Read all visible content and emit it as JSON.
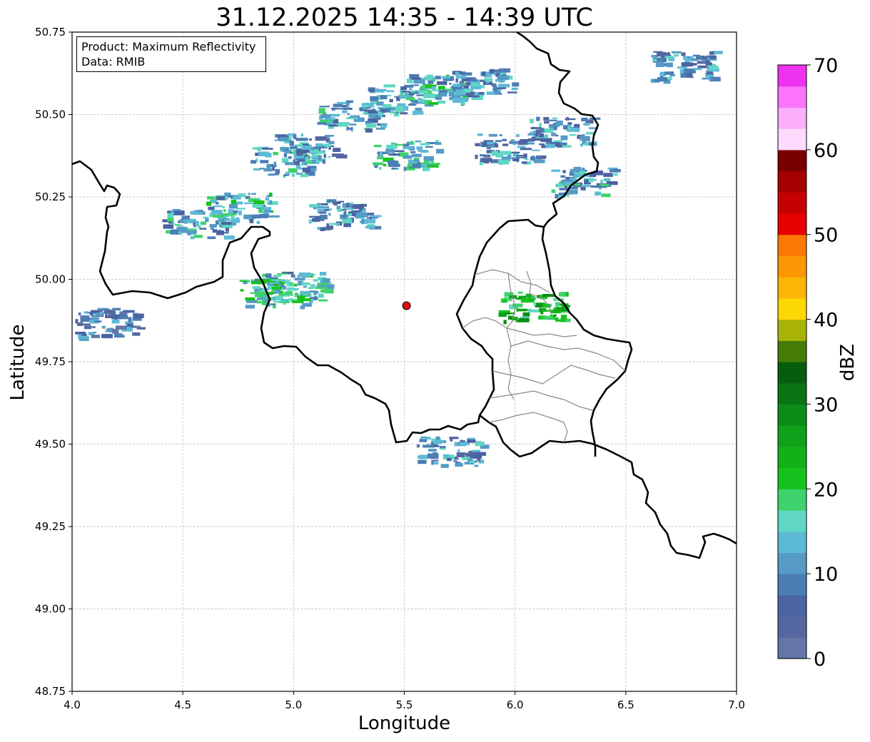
{
  "title": "31.12.2025 14:35 - 14:39 UTC",
  "infobox": {
    "product_line": "Product: Maximum Reflectivity",
    "data_line": "Data: RMIB"
  },
  "axes": {
    "xlabel": "Longitude",
    "ylabel": "Latitude",
    "xlim": [
      4.0,
      7.0
    ],
    "ylim": [
      48.75,
      50.75
    ],
    "xticks": [
      "4.0",
      "4.5",
      "5.0",
      "5.5",
      "6.0",
      "6.5",
      "7.0"
    ],
    "yticks": [
      "48.75",
      "49.00",
      "49.25",
      "49.50",
      "49.75",
      "50.00",
      "50.25",
      "50.50",
      "50.75"
    ],
    "grid": true
  },
  "radar_site": {
    "lon": 5.51,
    "lat": 49.92,
    "color": "#e01010"
  },
  "colorbar": {
    "label": "dBZ",
    "min": 0,
    "max": 70,
    "ticks": [
      "0",
      "10",
      "20",
      "30",
      "40",
      "50",
      "60",
      "70"
    ],
    "colors": [
      "#6475a8",
      "#5567a0",
      "#4a63a2",
      "#4c7db4",
      "#559bc6",
      "#5dbad6",
      "#60d7c4",
      "#3fd26c",
      "#16c31e",
      "#11b218",
      "#0fa11a",
      "#0c8b16",
      "#0a7413",
      "#065d0e",
      "#457c08",
      "#a9b307",
      "#fcd704",
      "#fbb603",
      "#fb9703",
      "#fb7805",
      "#e60000",
      "#c40000",
      "#a50000",
      "#780000",
      "#fedbfe",
      "#fcaffc",
      "#fb74fb",
      "#ee33ee"
    ]
  },
  "chart_data": {
    "type": "heatmap",
    "title": "31.12.2025 14:35 - 14:39 UTC",
    "xlabel": "Longitude",
    "ylabel": "Latitude",
    "xlim": [
      4.0,
      7.0
    ],
    "ylim": [
      48.75,
      50.75
    ],
    "value_label": "dBZ",
    "value_range": [
      0,
      70
    ],
    "reflectivity_clusters": [
      {
        "lon": 4.55,
        "lat": 50.17,
        "dbz": 12
      },
      {
        "lon": 4.75,
        "lat": 50.22,
        "dbz": 14
      },
      {
        "lon": 4.95,
        "lat": 50.36,
        "dbz": 12
      },
      {
        "lon": 5.05,
        "lat": 50.4,
        "dbz": 10
      },
      {
        "lon": 5.25,
        "lat": 50.5,
        "dbz": 12
      },
      {
        "lon": 5.45,
        "lat": 50.55,
        "dbz": 12
      },
      {
        "lon": 5.65,
        "lat": 50.58,
        "dbz": 14
      },
      {
        "lon": 5.85,
        "lat": 50.6,
        "dbz": 10
      },
      {
        "lon": 5.5,
        "lat": 50.38,
        "dbz": 14
      },
      {
        "lon": 5.2,
        "lat": 50.2,
        "dbz": 10
      },
      {
        "lon": 5.0,
        "lat": 49.98,
        "dbz": 14
      },
      {
        "lon": 4.9,
        "lat": 49.96,
        "dbz": 16
      },
      {
        "lon": 5.95,
        "lat": 50.4,
        "dbz": 10
      },
      {
        "lon": 6.2,
        "lat": 50.45,
        "dbz": 10
      },
      {
        "lon": 6.3,
        "lat": 50.3,
        "dbz": 12
      },
      {
        "lon": 6.75,
        "lat": 50.65,
        "dbz": 10
      },
      {
        "lon": 4.15,
        "lat": 49.87,
        "dbz": 8
      },
      {
        "lon": 5.7,
        "lat": 49.48,
        "dbz": 10
      },
      {
        "lon": 6.07,
        "lat": 49.92,
        "dbz": 22
      }
    ]
  }
}
